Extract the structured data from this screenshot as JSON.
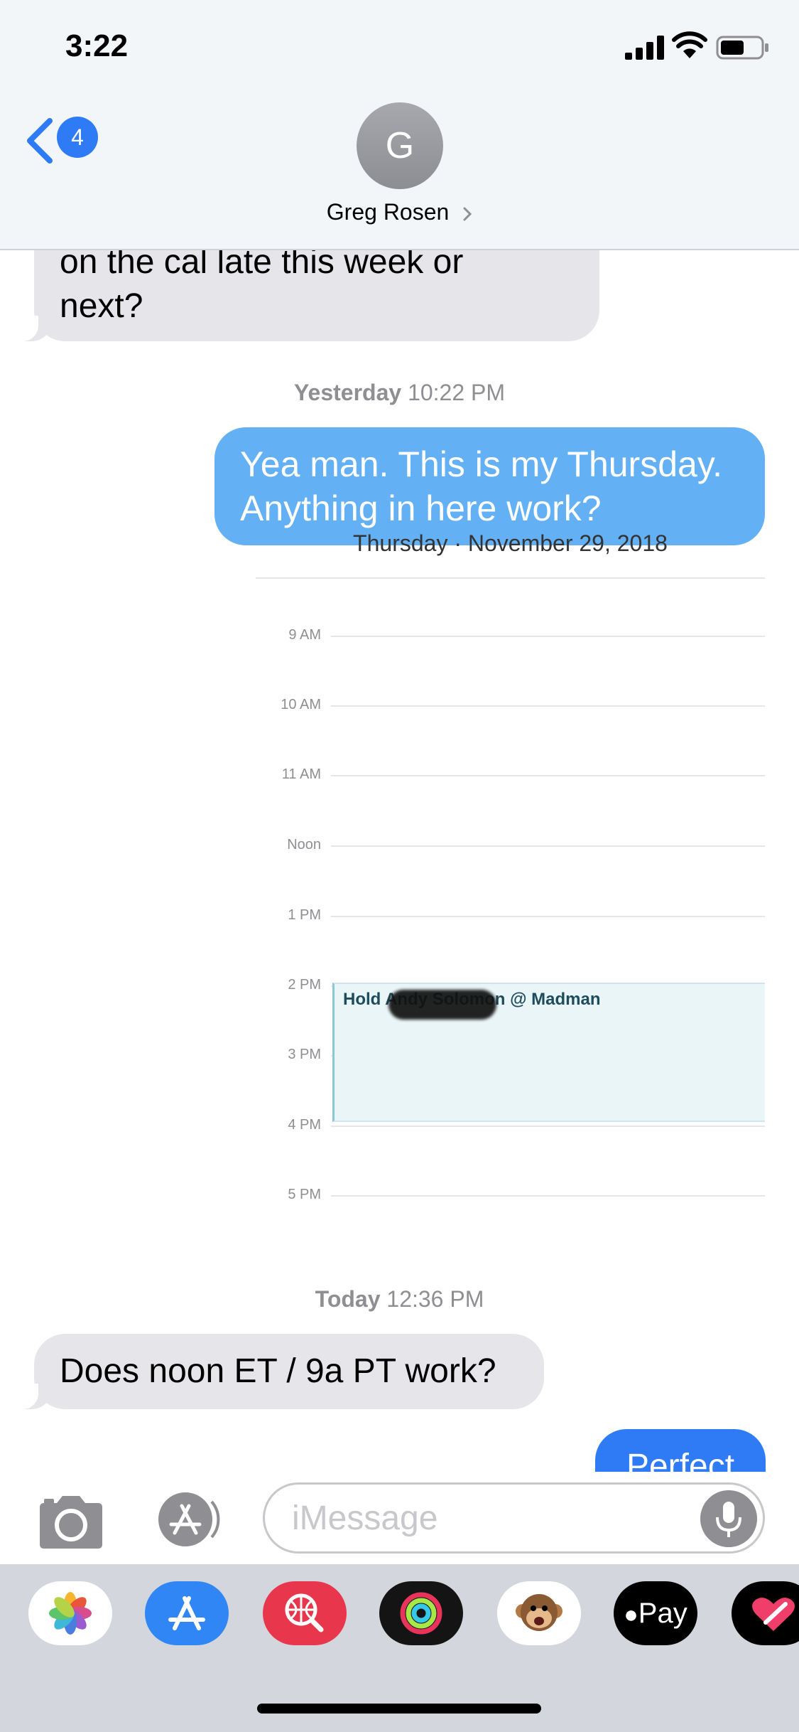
{
  "status_bar": {
    "time": "3:22",
    "icons": [
      "cellular-signal-icon",
      "wifi-icon",
      "battery-icon"
    ]
  },
  "header": {
    "back_badge": "4",
    "contact_initial": "G",
    "contact_name": "Greg Rosen"
  },
  "messages": [
    {
      "direction": "incoming",
      "text_line_1": "on the cal late this week or",
      "text_line_2": "next?"
    },
    {
      "direction": "outgoing",
      "text_line_1": "Yea man. This is my Thursday.",
      "text_line_2": "Anything in here work?"
    },
    {
      "direction": "incoming",
      "text": "Does noon ET / 9a PT work?"
    },
    {
      "direction": "outgoing",
      "text": "Perfect"
    }
  ],
  "timestamps": {
    "yesterday": {
      "day": "Yesterday",
      "time": "10:22 PM"
    },
    "today": {
      "day": "Today",
      "time": "12:36 PM"
    }
  },
  "calendar": {
    "date": "Thursday · November 29, 2018",
    "hours": [
      "9 AM",
      "10 AM",
      "11 AM",
      "Noon",
      "1 PM",
      "2 PM",
      "3 PM",
      "4 PM",
      "5 PM"
    ],
    "event": {
      "title": "Hold Andy Solomon @ Madman",
      "start": "2 PM",
      "end": "4 PM"
    }
  },
  "input": {
    "placeholder": "iMessage",
    "value": ""
  },
  "app_drawer": {
    "apps": [
      "photos-icon",
      "app-store-icon",
      "web-images-icon",
      "activity-icon",
      "animoji-icon",
      "apple-pay-icon",
      "digital-touch-icon"
    ],
    "apple_pay_label": "Pay"
  },
  "colors": {
    "outgoing_bubble": "#64b0f4",
    "incoming_bubble": "#e5e5ea",
    "accent": "#2f7bf6",
    "event_fill": "#e9f5f7"
  }
}
